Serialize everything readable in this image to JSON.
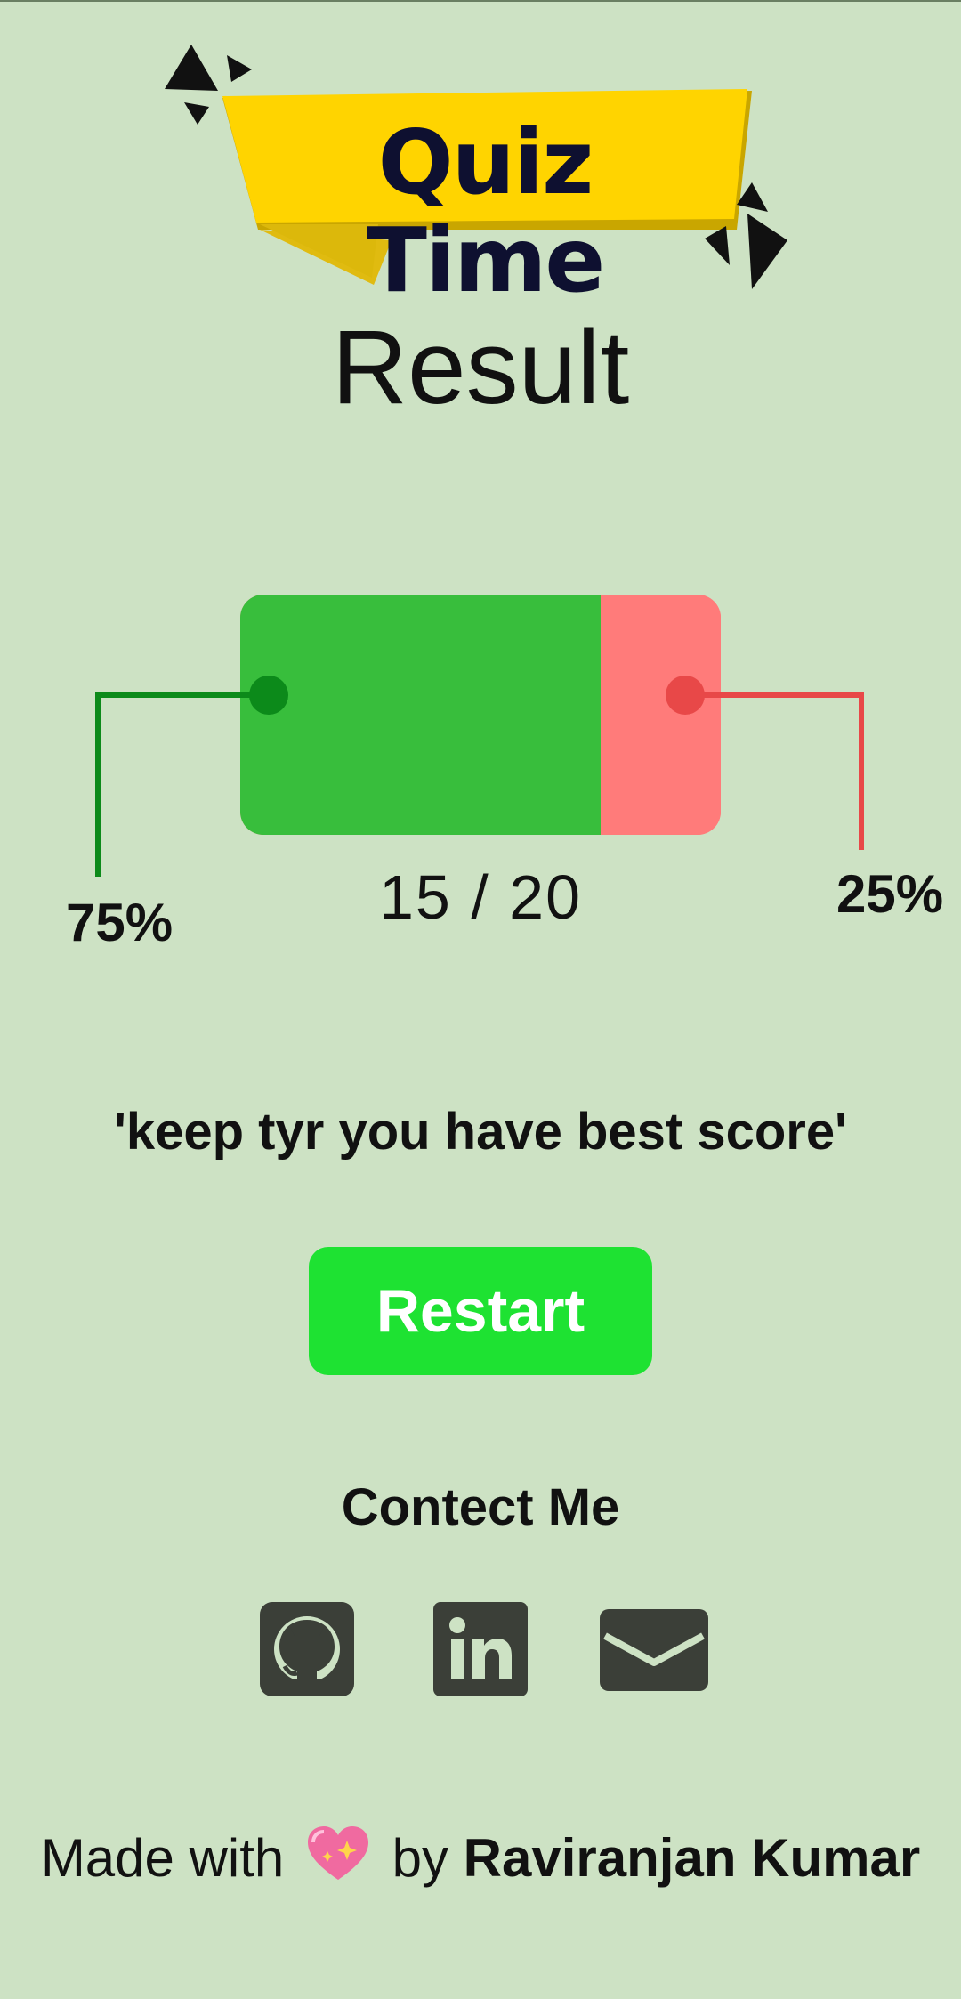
{
  "logo": {
    "text": "Quiz Time"
  },
  "page": {
    "title": "Result"
  },
  "result": {
    "correct_fraction": 0.75,
    "wrong_fraction": 0.25,
    "correct_percent_label": "75%",
    "wrong_percent_label": "25%",
    "score_label": "15 / 20",
    "correct_color": "#38be3c",
    "wrong_color": "#ff7b7a"
  },
  "message": "'keep tyr you have best score'",
  "restart": {
    "label": "Restart",
    "color": "#1ee232"
  },
  "contact": {
    "title": "Contect Me",
    "links": [
      {
        "icon": "github-icon"
      },
      {
        "icon": "linkedin-icon"
      },
      {
        "icon": "mail-icon"
      }
    ],
    "icon_color": "#3b3f38"
  },
  "footer": {
    "made_with": "Made with",
    "by": "by",
    "author": "Raviranjan Kumar",
    "heart_icon": "sparkling-heart-icon"
  }
}
